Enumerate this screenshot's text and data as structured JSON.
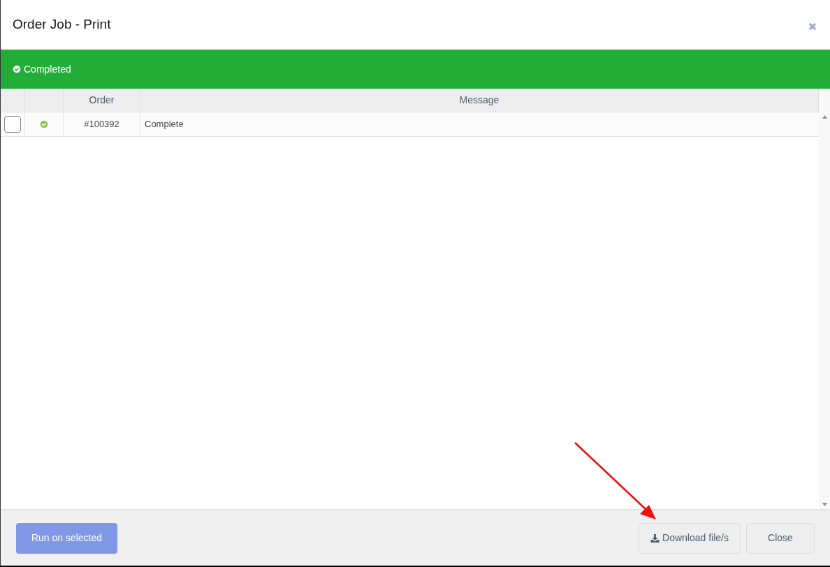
{
  "window": {
    "title": "Order Job - Print"
  },
  "status_banner": {
    "text": "Completed",
    "kind": "success"
  },
  "table": {
    "columns": [
      "",
      "",
      "Order",
      "Message"
    ],
    "rows": [
      {
        "checked": false,
        "success": true,
        "order": "#100392",
        "message": "Complete"
      }
    ]
  },
  "footer": {
    "buttons": [
      {
        "label": "Run on selected",
        "kind": "primary",
        "disabled": true
      },
      {
        "label": "Download file/s",
        "kind": "download",
        "disabled": false
      },
      {
        "label": "Close",
        "kind": "default",
        "disabled": false
      }
    ]
  }
}
